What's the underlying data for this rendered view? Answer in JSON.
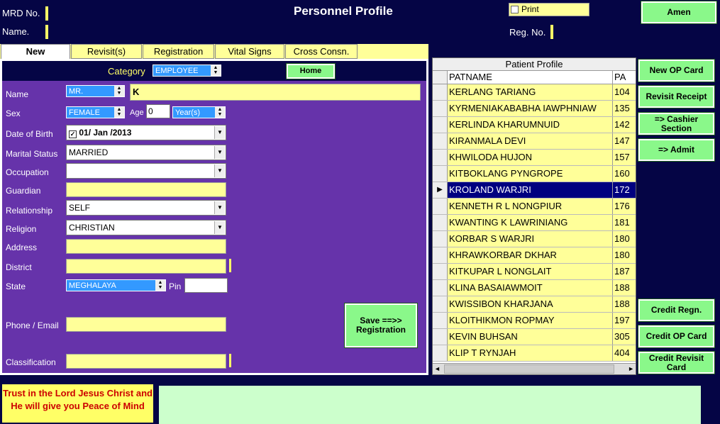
{
  "header": {
    "mrd_label": "MRD No.",
    "name_label": "Name.",
    "title": "Personnel Profile",
    "print_label": "Print",
    "reg_label": "Reg. No.",
    "amen_button": "Amen"
  },
  "tabs": [
    "New",
    "Revisit(s)",
    "Registration",
    "Vital Signs",
    "Cross Consn."
  ],
  "form": {
    "category_label": "Category",
    "category_value": "EMPLOYEE",
    "home_button": "Home",
    "name_label": "Name",
    "title_value": "MR.",
    "name_value": "K",
    "sex_label": "Sex",
    "sex_value": "FEMALE",
    "age_label": "Age",
    "age_value": "0",
    "age_unit": "Year(s)",
    "dob_label": "Date of Birth",
    "dob_value": "01/ Jan /2013",
    "marital_label": "Marital Status",
    "marital_value": "MARRIED",
    "occupation_label": "Occupation",
    "occupation_value": "",
    "guardian_label": "Guardian",
    "relationship_label": "Relationship",
    "relationship_value": "SELF",
    "religion_label": "Religion",
    "religion_value": "CHRISTIAN",
    "address_label": "Address",
    "district_label": "District",
    "state_label": "State",
    "state_value": "MEGHALAYA",
    "pin_label": "Pin",
    "phone_label": "Phone / Email",
    "classification_label": "Classification",
    "save_button": "Save ==>> Registration"
  },
  "patient_profile": {
    "title": "Patient Profile",
    "col1": "PATNAME",
    "col2": "PA",
    "rows": [
      {
        "name": "KERLANG TARIANG",
        "id": "104"
      },
      {
        "name": "KYRMENIAKABABHA IAWPHNIAW",
        "id": "135"
      },
      {
        "name": "KERLINDA KHARUMNUID",
        "id": "142"
      },
      {
        "name": "KIRANMALA DEVI",
        "id": "147"
      },
      {
        "name": "KHWILODA HUJON",
        "id": "157"
      },
      {
        "name": "KITBOKLANG PYNGROPE",
        "id": "160"
      },
      {
        "name": "KROLAND WARJRI",
        "id": "172"
      },
      {
        "name": "KENNETH R L NONGPIUR",
        "id": "176"
      },
      {
        "name": "KWANTING K LAWRINIANG",
        "id": "181"
      },
      {
        "name": "KORBAR S WARJRI",
        "id": "180"
      },
      {
        "name": "KHRAWKORBAR DKHAR",
        "id": "180"
      },
      {
        "name": "KITKUPAR L NONGLAIT",
        "id": "187"
      },
      {
        "name": "KLINA BASAIAWMOIT",
        "id": "188"
      },
      {
        "name": "KWISSIBON KHARJANA",
        "id": "188"
      },
      {
        "name": "KLOITHIKMON ROPMAY",
        "id": "197"
      },
      {
        "name": "KEVIN BUHSAN",
        "id": "305"
      },
      {
        "name": "KLIP T RYNJAH",
        "id": "404"
      }
    ],
    "selected_index": 6
  },
  "side_buttons": {
    "new_op_card": "New OP Card",
    "revisit_receipt": "Revisit Receipt",
    "cashier": "=> Cashier Section",
    "admit": "=> Admit",
    "credit_regn": "Credit Regn.",
    "credit_op": "Credit OP Card",
    "credit_revisit": "Credit Revisit Card"
  },
  "footer": {
    "motto_line1": "Trust in the Lord Jesus Christ and",
    "motto_line2": "He will give you Peace of Mind",
    "motto_color": "#cc0000"
  }
}
